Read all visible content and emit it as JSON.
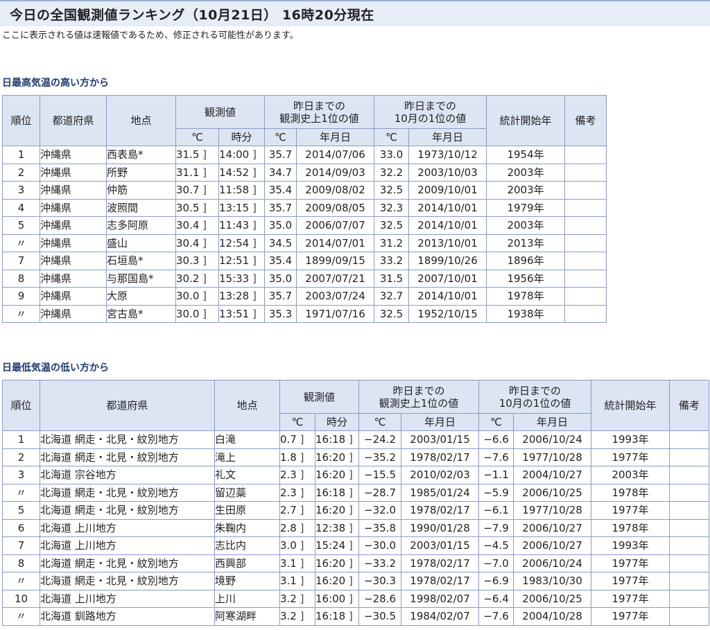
{
  "page": {
    "title": "今日の全国観測値ランキング（10月21日） 16時20分現在",
    "note": "ここに表示される値は速報値であるため、修正される可能性があります。"
  },
  "headers": {
    "rank": "順位",
    "pref": "都道府県",
    "station": "地点",
    "observed": "観測値",
    "record_all": "昨日までの観測史上1位の値",
    "record_month": "昨日までの10月の1位の値",
    "start_year": "統計開始年",
    "remarks": "備考",
    "celsius": "℃",
    "time": "時分",
    "date": "年月日"
  },
  "high_table": {
    "title": "日最高気温の高い方から",
    "rows": [
      {
        "rank": "1",
        "pref": "沖縄県",
        "station": "西表島*",
        "value": "31.5",
        "time": "14:00",
        "rec_val": "35.7",
        "rec_date": "2014/07/06",
        "mon_val": "33.0",
        "mon_date": "1973/10/12",
        "start": "1954年",
        "remarks": ""
      },
      {
        "rank": "2",
        "pref": "沖縄県",
        "station": "所野",
        "value": "31.1",
        "time": "14:52",
        "rec_val": "34.7",
        "rec_date": "2014/09/03",
        "mon_val": "32.2",
        "mon_date": "2003/10/03",
        "start": "2003年",
        "remarks": ""
      },
      {
        "rank": "3",
        "pref": "沖縄県",
        "station": "仲筋",
        "value": "30.7",
        "time": "11:58",
        "rec_val": "35.4",
        "rec_date": "2009/08/02",
        "mon_val": "32.5",
        "mon_date": "2009/10/01",
        "start": "2003年",
        "remarks": ""
      },
      {
        "rank": "4",
        "pref": "沖縄県",
        "station": "波照間",
        "value": "30.5",
        "time": "13:15",
        "rec_val": "35.7",
        "rec_date": "2009/08/05",
        "mon_val": "32.3",
        "mon_date": "2014/10/01",
        "start": "1979年",
        "remarks": ""
      },
      {
        "rank": "5",
        "pref": "沖縄県",
        "station": "志多阿原",
        "value": "30.4",
        "time": "11:43",
        "rec_val": "35.0",
        "rec_date": "2006/07/07",
        "mon_val": "32.5",
        "mon_date": "2014/10/01",
        "start": "2003年",
        "remarks": ""
      },
      {
        "rank": "〃",
        "pref": "沖縄県",
        "station": "盛山",
        "value": "30.4",
        "time": "12:54",
        "rec_val": "34.5",
        "rec_date": "2014/07/01",
        "mon_val": "31.2",
        "mon_date": "2013/10/01",
        "start": "2013年",
        "remarks": ""
      },
      {
        "rank": "7",
        "pref": "沖縄県",
        "station": "石垣島*",
        "value": "30.3",
        "time": "12:51",
        "rec_val": "35.4",
        "rec_date": "1899/09/15",
        "mon_val": "33.2",
        "mon_date": "1899/10/26",
        "start": "1896年",
        "remarks": ""
      },
      {
        "rank": "8",
        "pref": "沖縄県",
        "station": "与那国島*",
        "value": "30.2",
        "time": "15:33",
        "rec_val": "35.0",
        "rec_date": "2007/07/21",
        "mon_val": "31.5",
        "mon_date": "2007/10/01",
        "start": "1956年",
        "remarks": ""
      },
      {
        "rank": "9",
        "pref": "沖縄県",
        "station": "大原",
        "value": "30.0",
        "time": "13:28",
        "rec_val": "35.7",
        "rec_date": "2003/07/24",
        "mon_val": "32.7",
        "mon_date": "2014/10/01",
        "start": "1978年",
        "remarks": ""
      },
      {
        "rank": "〃",
        "pref": "沖縄県",
        "station": "宮古島*",
        "value": "30.0",
        "time": "13:51",
        "rec_val": "35.3",
        "rec_date": "1971/07/16",
        "mon_val": "32.5",
        "mon_date": "1952/10/15",
        "start": "1938年",
        "remarks": ""
      }
    ]
  },
  "low_table": {
    "title": "日最低気温の低い方から",
    "rows": [
      {
        "rank": "1",
        "pref": "北海道 網走・北見・紋別地方",
        "station": "白滝",
        "value": "0.7",
        "time": "16:18",
        "rec_val": "−24.2",
        "rec_date": "2003/01/15",
        "mon_val": "−6.6",
        "mon_date": "2006/10/24",
        "start": "1993年",
        "remarks": ""
      },
      {
        "rank": "2",
        "pref": "北海道 網走・北見・紋別地方",
        "station": "滝上",
        "value": "1.8",
        "time": "16:20",
        "rec_val": "−35.2",
        "rec_date": "1978/02/17",
        "mon_val": "−7.6",
        "mon_date": "1977/10/28",
        "start": "1977年",
        "remarks": ""
      },
      {
        "rank": "3",
        "pref": "北海道 宗谷地方",
        "station": "礼文",
        "value": "2.3",
        "time": "16:20",
        "rec_val": "−15.5",
        "rec_date": "2010/02/03",
        "mon_val": "−1.1",
        "mon_date": "2004/10/27",
        "start": "2003年",
        "remarks": ""
      },
      {
        "rank": "〃",
        "pref": "北海道 網走・北見・紋別地方",
        "station": "留辺蘂",
        "value": "2.3",
        "time": "16:18",
        "rec_val": "−28.7",
        "rec_date": "1985/01/24",
        "mon_val": "−5.9",
        "mon_date": "2006/10/25",
        "start": "1978年",
        "remarks": ""
      },
      {
        "rank": "5",
        "pref": "北海道 網走・北見・紋別地方",
        "station": "生田原",
        "value": "2.7",
        "time": "16:20",
        "rec_val": "−32.0",
        "rec_date": "1978/02/17",
        "mon_val": "−6.1",
        "mon_date": "1977/10/28",
        "start": "1977年",
        "remarks": ""
      },
      {
        "rank": "6",
        "pref": "北海道 上川地方",
        "station": "朱鞠内",
        "value": "2.8",
        "time": "12:38",
        "rec_val": "−35.8",
        "rec_date": "1990/01/28",
        "mon_val": "−7.9",
        "mon_date": "2006/10/27",
        "start": "1978年",
        "remarks": ""
      },
      {
        "rank": "7",
        "pref": "北海道 上川地方",
        "station": "志比内",
        "value": "3.0",
        "time": "15:24",
        "rec_val": "−30.0",
        "rec_date": "2003/01/15",
        "mon_val": "−4.5",
        "mon_date": "2006/10/27",
        "start": "1993年",
        "remarks": ""
      },
      {
        "rank": "8",
        "pref": "北海道 網走・北見・紋別地方",
        "station": "西興部",
        "value": "3.1",
        "time": "16:20",
        "rec_val": "−33.2",
        "rec_date": "1978/02/17",
        "mon_val": "−7.0",
        "mon_date": "2006/10/24",
        "start": "1977年",
        "remarks": ""
      },
      {
        "rank": "〃",
        "pref": "北海道 網走・北見・紋別地方",
        "station": "境野",
        "value": "3.1",
        "time": "16:20",
        "rec_val": "−30.3",
        "rec_date": "1978/02/17",
        "mon_val": "−6.9",
        "mon_date": "1983/10/30",
        "start": "1977年",
        "remarks": ""
      },
      {
        "rank": "10",
        "pref": "北海道 上川地方",
        "station": "上川",
        "value": "3.2",
        "time": "16:00",
        "rec_val": "−28.6",
        "rec_date": "1998/02/07",
        "mon_val": "−6.4",
        "mon_date": "2006/10/25",
        "start": "1977年",
        "remarks": ""
      },
      {
        "rank": "〃",
        "pref": "北海道 釧路地方",
        "station": "阿寒湖畔",
        "value": "3.2",
        "time": "16:18",
        "rec_val": "−30.5",
        "rec_date": "1984/02/07",
        "mon_val": "−7.6",
        "mon_date": "2004/10/28",
        "start": "1977年",
        "remarks": ""
      }
    ]
  }
}
